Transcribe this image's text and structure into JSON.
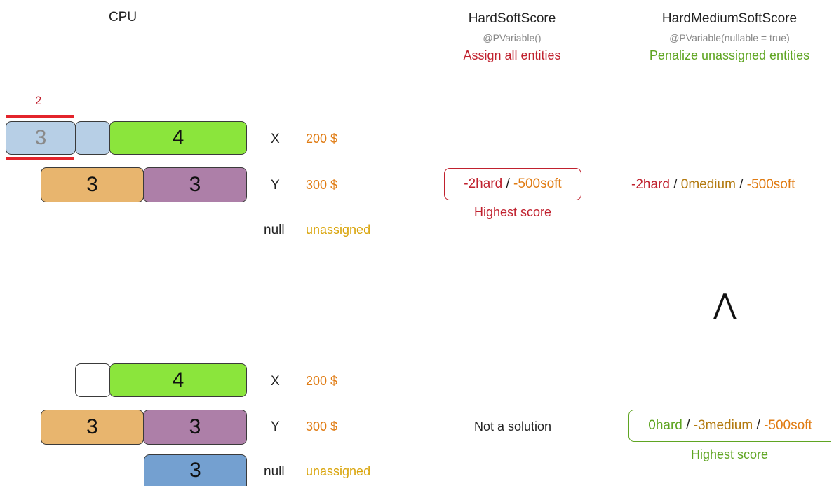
{
  "columns": {
    "cpu": {
      "title": "CPU"
    },
    "hardsoft": {
      "title": "HardSoftScore",
      "annotation": "@PVariable()",
      "note": "Assign all entities"
    },
    "hardmediumsoft": {
      "title": "HardMediumSoftScore",
      "annotation": "@PVariable(nullable = true)",
      "note": "Penalize unassigned entities"
    }
  },
  "colors": {
    "red": "#c0212e",
    "green": "#5fa522",
    "orange": "#e07b12",
    "blue_light": "#b7cfe6",
    "blue": "#74a0d0",
    "lime": "#8be53c",
    "tan": "#e8b56e",
    "purple": "#ad7fa8"
  },
  "top": {
    "overflow_label": "2",
    "processes": [
      {
        "name": "process-ghost-3",
        "value": "3"
      },
      {
        "name": "process-4",
        "value": "4"
      },
      {
        "name": "process-tan-3",
        "value": "3"
      },
      {
        "name": "process-purple-3",
        "value": "3"
      }
    ],
    "rows": [
      {
        "computer": "X",
        "cost": "200 $"
      },
      {
        "computer": "Y",
        "cost": "300 $"
      },
      {
        "computer": "null",
        "cost": "unassigned"
      }
    ],
    "hardsoft": {
      "hard": "-2hard",
      "sep": " / ",
      "soft": "-500soft",
      "caption": "Highest score"
    },
    "hardmediumsoft": {
      "hard": "-2hard",
      "sep1": " / ",
      "medium": "0medium",
      "sep2": " / ",
      "soft": "-500soft"
    }
  },
  "comparison_symbol": "⋀",
  "bottom": {
    "processes": [
      {
        "name": "process-4",
        "value": "4"
      },
      {
        "name": "process-tan-3",
        "value": "3"
      },
      {
        "name": "process-purple-3",
        "value": "3"
      },
      {
        "name": "process-unassigned-3",
        "value": "3"
      }
    ],
    "rows": [
      {
        "computer": "X",
        "cost": "200 $"
      },
      {
        "computer": "Y",
        "cost": "300 $"
      },
      {
        "computer": "null",
        "cost": "unassigned"
      }
    ],
    "hardsoft": {
      "text": "Not a solution"
    },
    "hardmediumsoft": {
      "hard": "0hard",
      "sep1": " / ",
      "medium": "-3medium",
      "sep2": " / ",
      "soft": "-500soft",
      "caption": "Highest score"
    }
  }
}
